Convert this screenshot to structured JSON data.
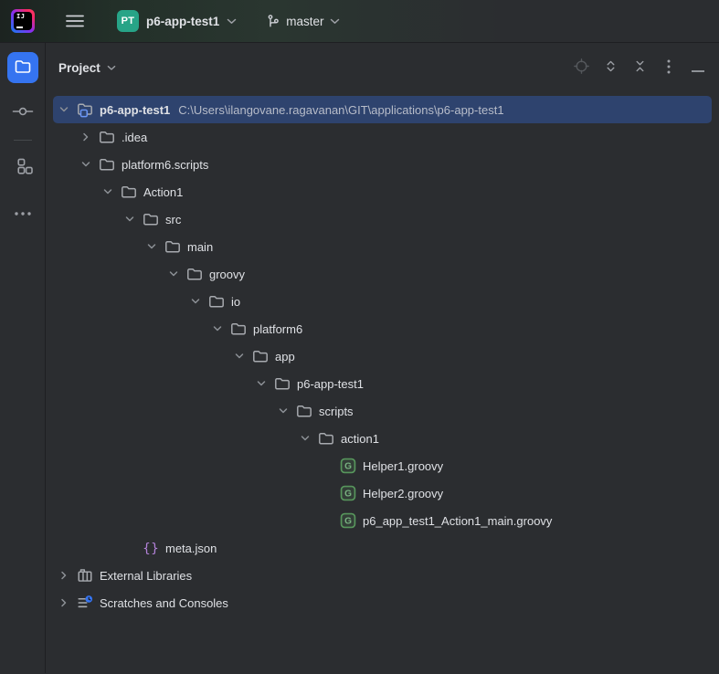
{
  "top_bar": {
    "logo": "intellij-idea-logo",
    "menu_icon": "hamburger-menu-icon",
    "project": {
      "badge": "PT",
      "name": "p6-app-test1",
      "dropdown_icon": "chevron-down-icon"
    },
    "branch": {
      "icon": "git-branch-icon",
      "name": "master",
      "dropdown_icon": "chevron-down-icon"
    }
  },
  "tool_stripe": {
    "items": [
      {
        "name": "project-tool-button",
        "icon": "folder-icon",
        "active": true
      },
      {
        "name": "commit-tool-button",
        "icon": "commit-icon",
        "active": false
      },
      {
        "name": "structure-tool-button",
        "icon": "structure-icon",
        "active": false
      },
      {
        "name": "more-tools-button",
        "icon": "more-dots-icon",
        "active": false
      }
    ]
  },
  "panel": {
    "title": "Project",
    "title_dropdown_icon": "chevron-down-icon",
    "actions": [
      {
        "name": "locate-file-button",
        "icon": "target-icon",
        "enabled": false
      },
      {
        "name": "expand-all-button",
        "icon": "expand-all-icon",
        "enabled": true
      },
      {
        "name": "collapse-all-button",
        "icon": "collapse-all-icon",
        "enabled": true
      },
      {
        "name": "more-options-button",
        "icon": "kebab-menu-icon",
        "enabled": true
      },
      {
        "name": "hide-panel-button",
        "icon": "minimize-icon",
        "enabled": true
      }
    ]
  },
  "tree": {
    "rows": [
      {
        "level": 0,
        "chevron": "expanded",
        "icon": "project-folder-icon",
        "label": "p6-app-test1",
        "bold": true,
        "path": "C:\\Users\\ilangovane.ragavanan\\GIT\\applications\\p6-app-test1",
        "selected": true
      },
      {
        "level": 1,
        "chevron": "collapsed",
        "icon": "folder-icon",
        "label": ".idea"
      },
      {
        "level": 1,
        "chevron": "expanded",
        "icon": "folder-icon",
        "label": "platform6.scripts"
      },
      {
        "level": 2,
        "chevron": "expanded",
        "icon": "folder-icon",
        "label": "Action1"
      },
      {
        "level": 3,
        "chevron": "expanded",
        "icon": "folder-icon",
        "label": "src"
      },
      {
        "level": 4,
        "chevron": "expanded",
        "icon": "folder-icon",
        "label": "main"
      },
      {
        "level": 5,
        "chevron": "expanded",
        "icon": "folder-icon",
        "label": "groovy"
      },
      {
        "level": 6,
        "chevron": "expanded",
        "icon": "folder-icon",
        "label": "io"
      },
      {
        "level": 7,
        "chevron": "expanded",
        "icon": "folder-icon",
        "label": "platform6"
      },
      {
        "level": 8,
        "chevron": "expanded",
        "icon": "folder-icon",
        "label": "app"
      },
      {
        "level": 9,
        "chevron": "expanded",
        "icon": "folder-icon",
        "label": "p6-app-test1"
      },
      {
        "level": 10,
        "chevron": "expanded",
        "icon": "folder-icon",
        "label": "scripts"
      },
      {
        "level": 11,
        "chevron": "expanded",
        "icon": "folder-icon",
        "label": "action1"
      },
      {
        "level": 12,
        "chevron": "none",
        "icon": "groovy-file-icon",
        "label": "Helper1.groovy"
      },
      {
        "level": 12,
        "chevron": "none",
        "icon": "groovy-file-icon",
        "label": "Helper2.groovy"
      },
      {
        "level": 12,
        "chevron": "none",
        "icon": "groovy-file-icon",
        "label": "p6_app_test1_Action1_main.groovy"
      },
      {
        "level": 3,
        "chevron": "none",
        "icon": "json-file-icon",
        "label": "meta.json"
      },
      {
        "level": 0,
        "chevron": "collapsed",
        "icon": "library-icon",
        "label": "External Libraries"
      },
      {
        "level": 0,
        "chevron": "collapsed",
        "icon": "scratches-icon",
        "label": "Scratches and Consoles"
      }
    ]
  },
  "colors": {
    "accent_blue": "#3574f0",
    "selection_blue": "#2e436e",
    "project_badge_teal": "#27a487",
    "groovy_green": "#57965c",
    "json_purple": "#b382d9",
    "background": "#2b2d30"
  }
}
